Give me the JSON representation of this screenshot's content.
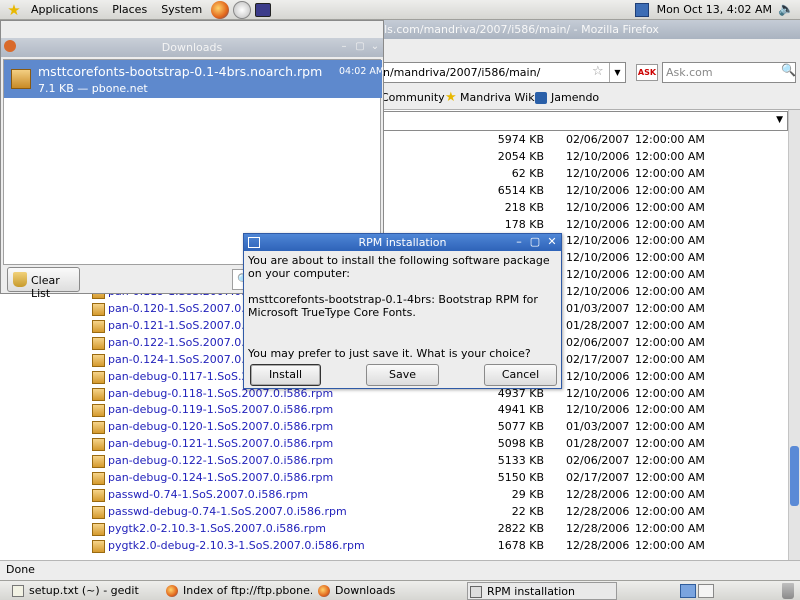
{
  "top_panel": {
    "menus": [
      "Applications",
      "Places",
      "System"
    ],
    "clock": "Mon Oct 13,  4:02 AM"
  },
  "firefox": {
    "title": "Index of ftp://ftp.pbone.net/mirror/seerofsouls.com/mandriva/2007/i586/main/ - Mozilla Firefox",
    "url": "n/mandriva/2007/i586/main/",
    "search_placeholder": "Ask.com",
    "search_engine_label": "ASK",
    "bookmarks": [
      "Community",
      "Mandriva Wiki",
      "Jamendo"
    ],
    "status": "Done",
    "files": [
      {
        "name": "",
        "size": "5974 KB",
        "date": "02/06/2007",
        "time": "12:00:00 AM"
      },
      {
        "name": "",
        "size": "2054 KB",
        "date": "12/10/2006",
        "time": "12:00:00 AM"
      },
      {
        "name": "",
        "size": "62 KB",
        "date": "12/10/2006",
        "time": "12:00:00 AM"
      },
      {
        "name": "",
        "size": "6514 KB",
        "date": "12/10/2006",
        "time": "12:00:00 AM"
      },
      {
        "name": "",
        "size": "218 KB",
        "date": "12/10/2006",
        "time": "12:00:00 AM"
      },
      {
        "name": "",
        "size": "178 KB",
        "date": "12/10/2006",
        "time": "12:00:00 AM"
      },
      {
        "name": "",
        "size": "",
        "date": "12/10/2006",
        "time": "12:00:00 AM"
      },
      {
        "name": "",
        "size": "",
        "date": "12/10/2006",
        "time": "12:00:00 AM"
      },
      {
        "name": "",
        "size": "",
        "date": "12/10/2006",
        "time": "12:00:00 AM"
      },
      {
        "name": "pan-0.119-1.SoS.2007.0.i58",
        "size": "",
        "date": "12/10/2006",
        "time": "12:00:00 AM"
      },
      {
        "name": "pan-0.120-1.SoS.2007.0.i58",
        "size": "",
        "date": "01/03/2007",
        "time": "12:00:00 AM"
      },
      {
        "name": "pan-0.121-1.SoS.2007.0.i58",
        "size": "",
        "date": "01/28/2007",
        "time": "12:00:00 AM"
      },
      {
        "name": "pan-0.122-1.SoS.2007.0.i58",
        "size": "",
        "date": "02/06/2007",
        "time": "12:00:00 AM"
      },
      {
        "name": "pan-0.124-1.SoS.2007.0.i58",
        "size": "",
        "date": "02/17/2007",
        "time": "12:00:00 AM"
      },
      {
        "name": "pan-debug-0.117-1.SoS.2007.0.i586.rpm",
        "size": "4926 KB",
        "date": "12/10/2006",
        "time": "12:00:00 AM"
      },
      {
        "name": "pan-debug-0.118-1.SoS.2007.0.i586.rpm",
        "size": "4937 KB",
        "date": "12/10/2006",
        "time": "12:00:00 AM"
      },
      {
        "name": "pan-debug-0.119-1.SoS.2007.0.i586.rpm",
        "size": "4941 KB",
        "date": "12/10/2006",
        "time": "12:00:00 AM"
      },
      {
        "name": "pan-debug-0.120-1.SoS.2007.0.i586.rpm",
        "size": "5077 KB",
        "date": "01/03/2007",
        "time": "12:00:00 AM"
      },
      {
        "name": "pan-debug-0.121-1.SoS.2007.0.i586.rpm",
        "size": "5098 KB",
        "date": "01/28/2007",
        "time": "12:00:00 AM"
      },
      {
        "name": "pan-debug-0.122-1.SoS.2007.0.i586.rpm",
        "size": "5133 KB",
        "date": "02/06/2007",
        "time": "12:00:00 AM"
      },
      {
        "name": "pan-debug-0.124-1.SoS.2007.0.i586.rpm",
        "size": "5150 KB",
        "date": "02/17/2007",
        "time": "12:00:00 AM"
      },
      {
        "name": "passwd-0.74-1.SoS.2007.0.i586.rpm",
        "size": "29 KB",
        "date": "12/28/2006",
        "time": "12:00:00 AM"
      },
      {
        "name": "passwd-debug-0.74-1.SoS.2007.0.i586.rpm",
        "size": "22 KB",
        "date": "12/28/2006",
        "time": "12:00:00 AM"
      },
      {
        "name": "pygtk2.0-2.10.3-1.SoS.2007.0.i586.rpm",
        "size": "2822 KB",
        "date": "12/28/2006",
        "time": "12:00:00 AM"
      },
      {
        "name": "pygtk2.0-debug-2.10.3-1.SoS.2007.0.i586.rpm",
        "size": "1678 KB",
        "date": "12/28/2006",
        "time": "12:00:00 AM"
      }
    ]
  },
  "downloads": {
    "title": "Downloads",
    "item": {
      "name": "msttcorefonts-bootstrap-0.1-4brs.noarch.rpm",
      "detail": "7.1 KB — pbone.net",
      "time": "04:02 AM"
    },
    "clear_label": "Clear List"
  },
  "rpm_dialog": {
    "title": "RPM installation",
    "message1": "You are about to install the following software package on your computer:",
    "message2": "msttcorefonts-bootstrap-0.1-4brs: Bootstrap RPM for Microsoft TrueType Core Fonts.",
    "message3": "You may prefer to just save it. What is your choice?",
    "install_label": "Install",
    "save_label": "Save",
    "cancel_label": "Cancel"
  },
  "taskbar": {
    "tasks": [
      "setup.txt (~) - gedit",
      "Index of ftp://ftp.pbone...",
      "Downloads",
      "RPM installation"
    ]
  }
}
